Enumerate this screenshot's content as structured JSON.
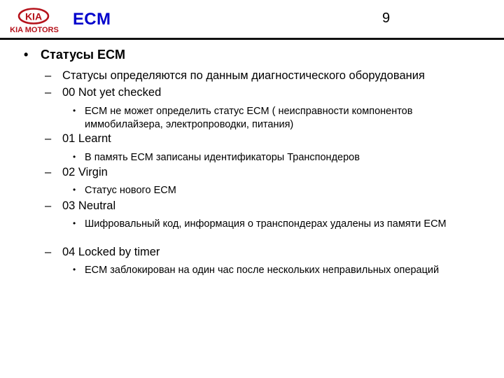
{
  "header": {
    "logo": {
      "brand_text": "KIA MOTORS",
      "emblem_text": "KIA",
      "color": "#b5121b"
    },
    "title": "ECM",
    "title_color": "#0000cc",
    "page_number": "9"
  },
  "content": {
    "heading": {
      "bullet": "•",
      "text": "Статусы ECM"
    },
    "items": [
      {
        "dash": "–",
        "text": "Статусы определяются по данным диагностического оборудования",
        "sub": []
      },
      {
        "dash": "–",
        "text": "00 Not yet checked",
        "sub": [
          {
            "bullet": "•",
            "text": "ECM не может определить статус ECM ( неисправности компонентов иммобилайзера, электропроводки, питания)"
          }
        ]
      },
      {
        "dash": "–",
        "text": "01 Learnt",
        "sub": [
          {
            "bullet": "•",
            "text": "В память ECM записаны идентификаторы Транспондеров"
          }
        ]
      },
      {
        "dash": "–",
        "text": "02 Virgin",
        "sub": [
          {
            "bullet": "•",
            "text": "Статус нового ECM"
          }
        ]
      },
      {
        "dash": "–",
        "text": "03 Neutral",
        "sub": [
          {
            "bullet": "•",
            "text": "Шифровальный код, информация о транспондерах удалены из памяти ECM"
          }
        ]
      },
      {
        "dash": "–",
        "text": "04 Locked by timer",
        "sub": [
          {
            "bullet": "•",
            "text": "ECM заблокирован на один час после нескольких неправильных операций"
          }
        ]
      }
    ]
  }
}
